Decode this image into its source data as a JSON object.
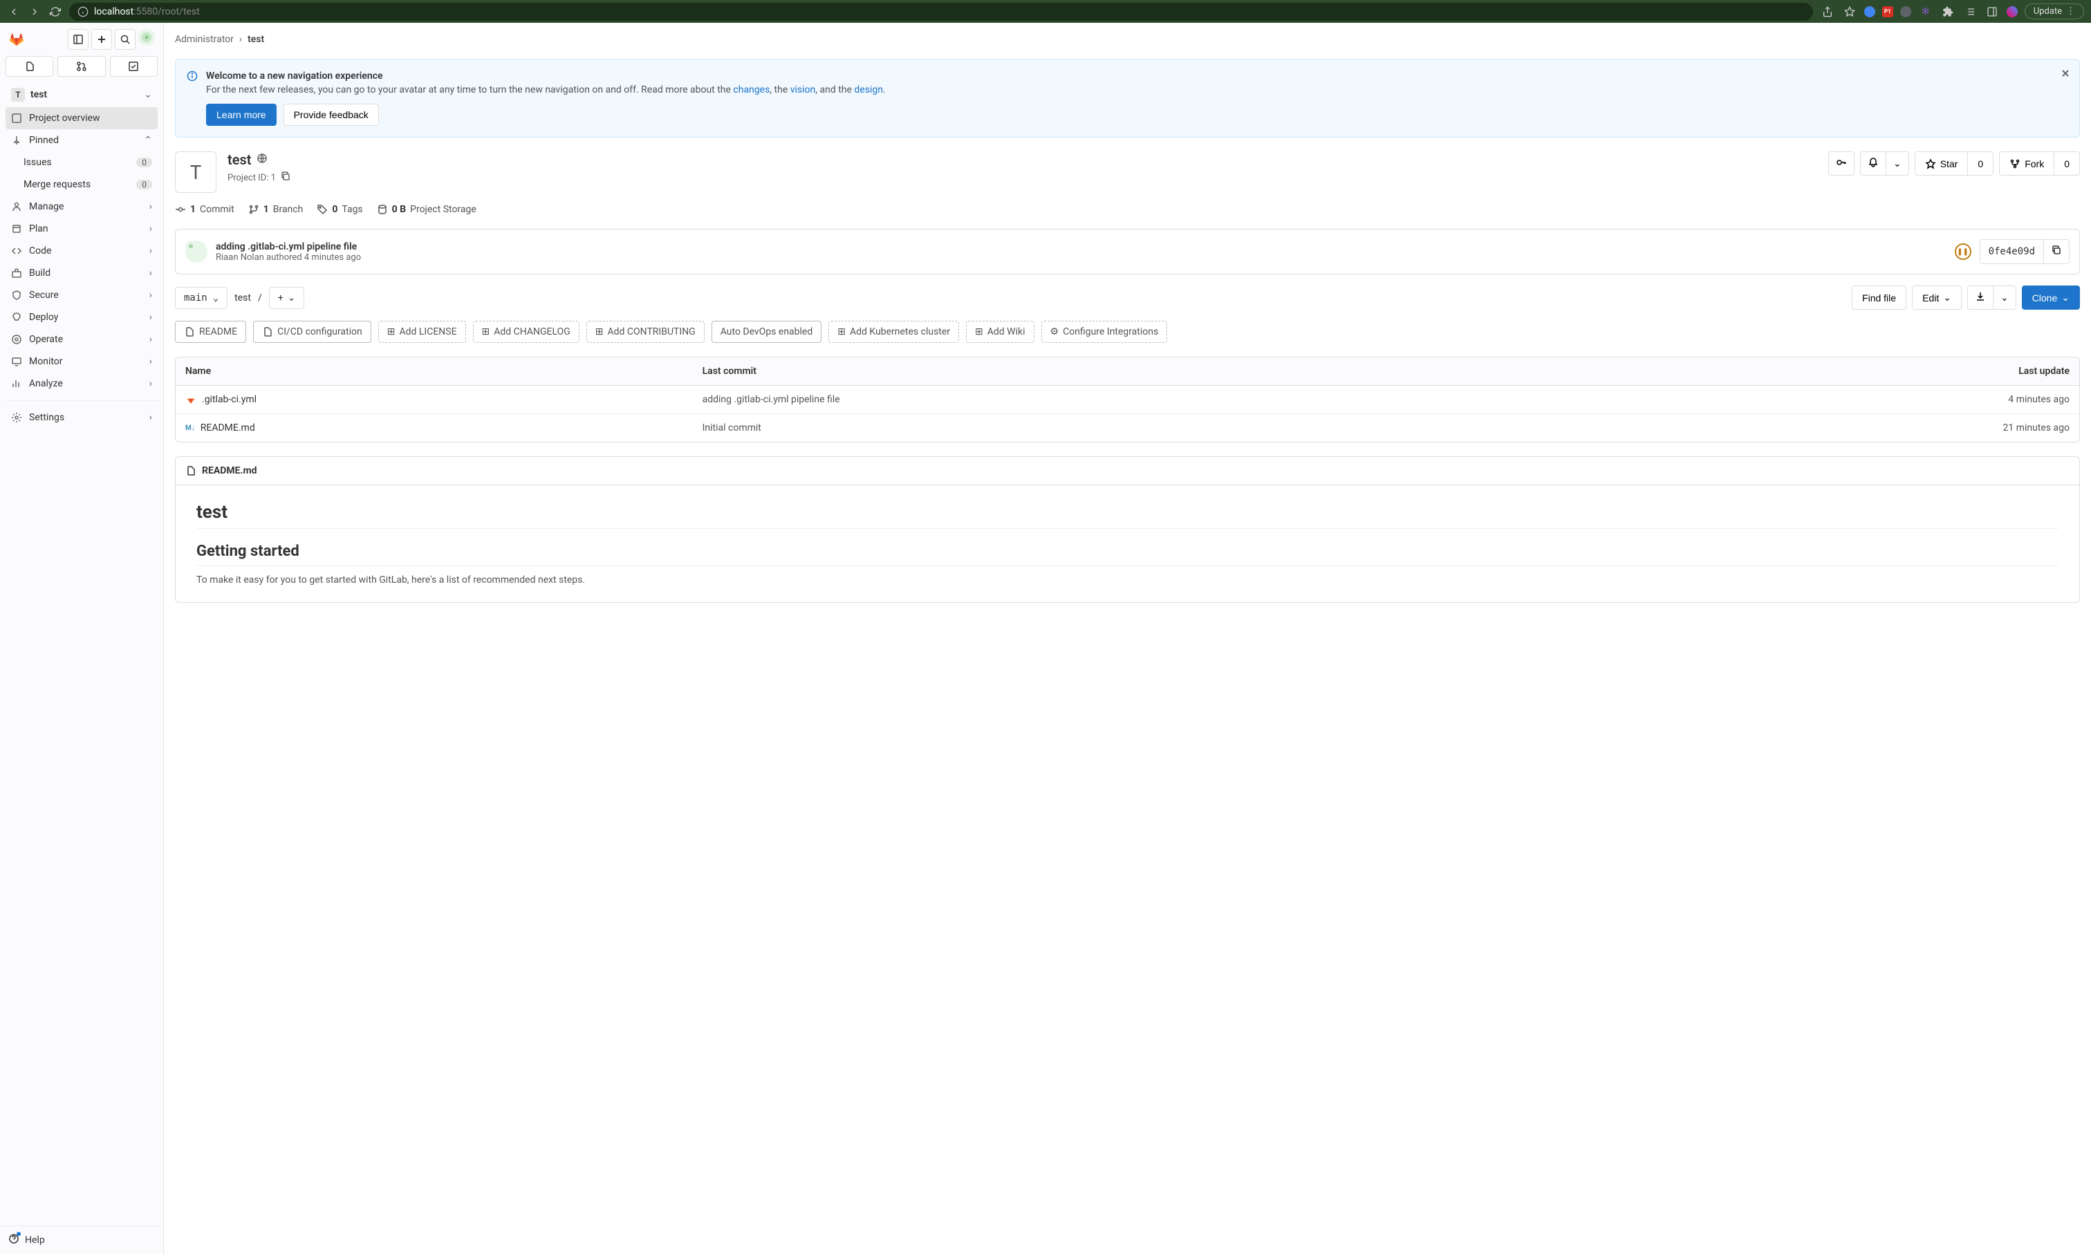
{
  "browser": {
    "url_host": "localhost",
    "url_port": ":5580",
    "url_path": "/root/test",
    "update": "Update"
  },
  "sidebar": {
    "project_badge": "T",
    "project_name": "test",
    "nav": {
      "overview": "Project overview",
      "pinned": "Pinned",
      "issues": "Issues",
      "issues_count": "0",
      "mrs": "Merge requests",
      "mrs_count": "0",
      "manage": "Manage",
      "plan": "Plan",
      "code": "Code",
      "build": "Build",
      "secure": "Secure",
      "deploy": "Deploy",
      "operate": "Operate",
      "monitor": "Monitor",
      "analyze": "Analyze",
      "settings": "Settings"
    },
    "help": "Help"
  },
  "breadcrumb": {
    "root": "Administrator",
    "current": "test"
  },
  "banner": {
    "title": "Welcome to a new navigation experience",
    "text_pre": "For the next few releases, you can go to your avatar at any time to turn the new navigation on and off. Read more about the ",
    "link_changes": "changes",
    "text_mid1": ", the ",
    "link_vision": "vision",
    "text_mid2": ", and the ",
    "link_design": "design",
    "text_post": ".",
    "learn_more": "Learn more",
    "feedback": "Provide feedback"
  },
  "project": {
    "avatar_letter": "T",
    "title": "test",
    "id_label": "Project ID: 1",
    "star": "Star",
    "star_count": "0",
    "fork": "Fork",
    "fork_count": "0"
  },
  "stats": {
    "commits_n": "1",
    "commits": "Commit",
    "branches_n": "1",
    "branches": "Branch",
    "tags_n": "0",
    "tags": "Tags",
    "storage_n": "0 B",
    "storage": "Project Storage"
  },
  "last_commit": {
    "message": "adding .gitlab-ci.yml pipeline file",
    "author_line": "Riaan Nolan authored 4 minutes ago",
    "sha": "0fe4e09d"
  },
  "file_nav": {
    "branch": "main",
    "path": "test",
    "sep": "/",
    "find_file": "Find file",
    "edit": "Edit",
    "clone": "Clone"
  },
  "chips": {
    "readme": "README",
    "cicd": "CI/CD configuration",
    "license": "Add LICENSE",
    "changelog": "Add CHANGELOG",
    "contributing": "Add CONTRIBUTING",
    "auto_devops": "Auto DevOps enabled",
    "k8s": "Add Kubernetes cluster",
    "wiki": "Add Wiki",
    "integrations": "Configure Integrations"
  },
  "table": {
    "h_name": "Name",
    "h_commit": "Last commit",
    "h_update": "Last update",
    "rows": [
      {
        "name": ".gitlab-ci.yml",
        "commit": "adding .gitlab-ci.yml pipeline file",
        "update": "4 minutes ago",
        "icon": "gitlab"
      },
      {
        "name": "README.md",
        "commit": "Initial commit",
        "update": "21 minutes ago",
        "icon": "md"
      }
    ]
  },
  "readme": {
    "filename": "README.md",
    "h1": "test",
    "h2": "Getting started",
    "p": "To make it easy for you to get started with GitLab, here's a list of recommended next steps."
  }
}
